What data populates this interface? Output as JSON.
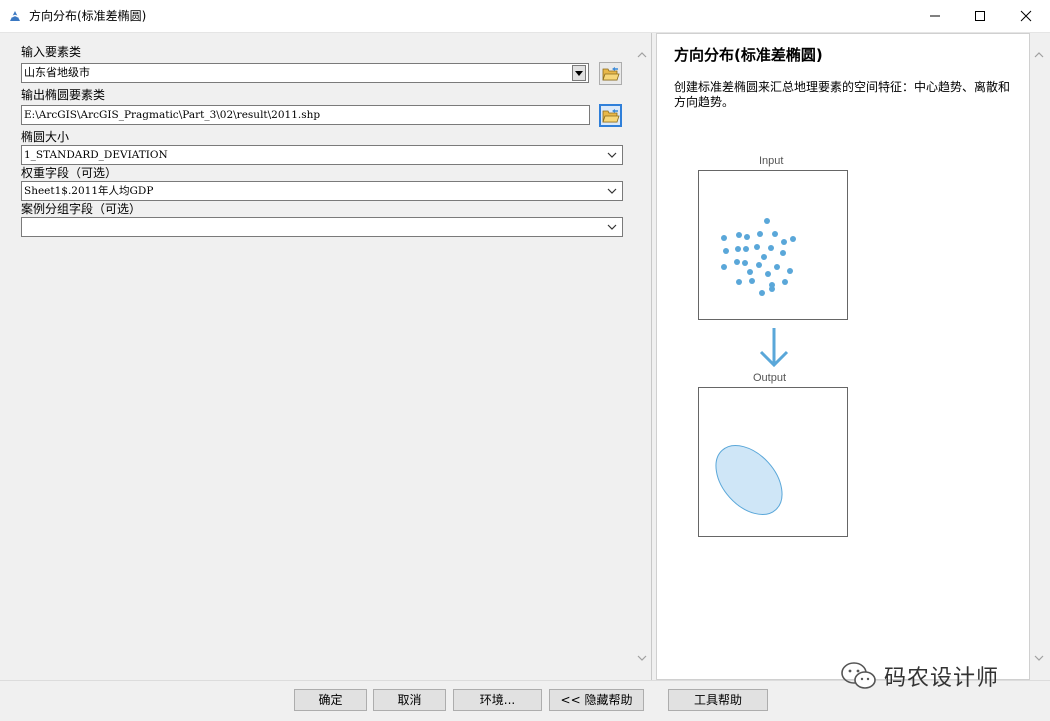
{
  "window": {
    "title": "方向分布(标准差椭圆)",
    "icon": "arcgis-tool-icon",
    "controls": [
      "minimize-icon",
      "maximize-icon",
      "close-icon"
    ]
  },
  "form": {
    "input_features": {
      "label": "输入要素类",
      "value": "山东省地级市"
    },
    "output_ellipse": {
      "label": "输出椭圆要素类",
      "value": "E:\\ArcGIS\\ArcGIS_Pragmatic\\Part_3\\02\\result\\2011.shp"
    },
    "ellipse_size": {
      "label": "椭圆大小",
      "value": "1_STANDARD_DEVIATION"
    },
    "weight_field": {
      "label": "权重字段（可选）",
      "value": "Sheet1$.2011年人均GDP"
    },
    "case_field": {
      "label": "案例分组字段（可选）",
      "value": ""
    }
  },
  "help": {
    "title": "方向分布(标准差椭圆)",
    "description": "创建标准差椭圆来汇总地理要素的空间特征：中心趋势、离散和方向趋势。",
    "diagram": {
      "input_label": "Input",
      "output_label": "Output",
      "accent_color": "#5aa7d9"
    }
  },
  "buttons": {
    "ok": "确定",
    "cancel": "取消",
    "environments": "环境...",
    "hide_help": "<< 隐藏帮助",
    "tool_help": "工具帮助"
  },
  "watermark": {
    "text": "码农设计师",
    "icon": "wechat-icon"
  }
}
